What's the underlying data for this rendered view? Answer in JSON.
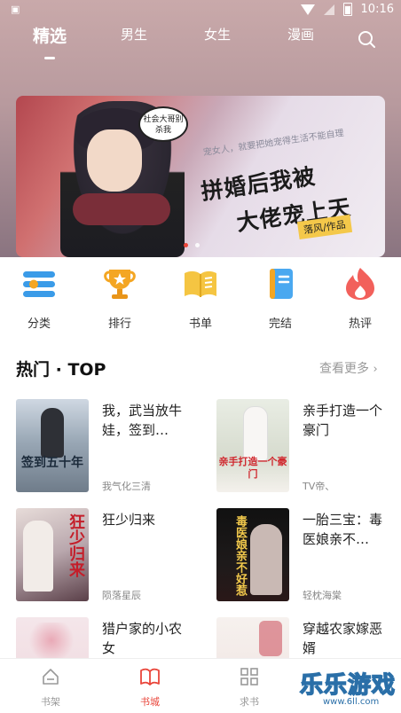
{
  "status_bar": {
    "time": "10:16"
  },
  "top_nav": {
    "tabs": [
      {
        "label": "精选",
        "active": true
      },
      {
        "label": "男生"
      },
      {
        "label": "女生"
      },
      {
        "label": "漫画"
      }
    ]
  },
  "banner": {
    "speech_bubble": "社会大哥别杀我",
    "tagline": "宠女人，就要把她宠得生活不能自理",
    "title_line1": "拼婚后我被",
    "title_line2": "大佬宠上天",
    "author": "落风/作品",
    "page_count": 2,
    "current_page": 1
  },
  "categories": [
    {
      "label": "分类",
      "icon": "category-icon",
      "color": "#3a9be8"
    },
    {
      "label": "排行",
      "icon": "trophy-icon",
      "color": "#f4a623"
    },
    {
      "label": "书单",
      "icon": "booklist-icon",
      "color": "#f5c542"
    },
    {
      "label": "完结",
      "icon": "finished-book-icon",
      "color": "#4aa8f0"
    },
    {
      "label": "热评",
      "icon": "fire-icon",
      "color": "#f2605b"
    }
  ],
  "hot_section": {
    "title": "热门 · TOP",
    "more_label": "查看更多",
    "books": [
      {
        "title": "我，武当放牛娃，签到…",
        "author": "我气化三清",
        "cover_text": "签到五十年"
      },
      {
        "title": "亲手打造一个豪门",
        "author": "TV帝、",
        "cover_text": "亲手打造一个豪门"
      },
      {
        "title": "狂少归来",
        "author": "陨落星辰",
        "cover_text": "狂少归来"
      },
      {
        "title": "一胎三宝：毒医娘亲不…",
        "author": "轻枕海棠",
        "cover_text": "毒医娘亲不好惹"
      },
      {
        "title": "猎户家的小农女",
        "author": "",
        "cover_text": ""
      },
      {
        "title": "穿越农家嫁恶婿",
        "author": "",
        "cover_text": ""
      }
    ]
  },
  "tab_bar": {
    "items": [
      {
        "label": "书架",
        "icon": "bookshelf-icon"
      },
      {
        "label": "书城",
        "icon": "open-book-icon",
        "active": true
      },
      {
        "label": "求书",
        "icon": "grid-icon"
      }
    ],
    "accent": "#e9453a"
  },
  "watermark": {
    "text": "乐乐游戏",
    "url": "www.6ll.com"
  }
}
